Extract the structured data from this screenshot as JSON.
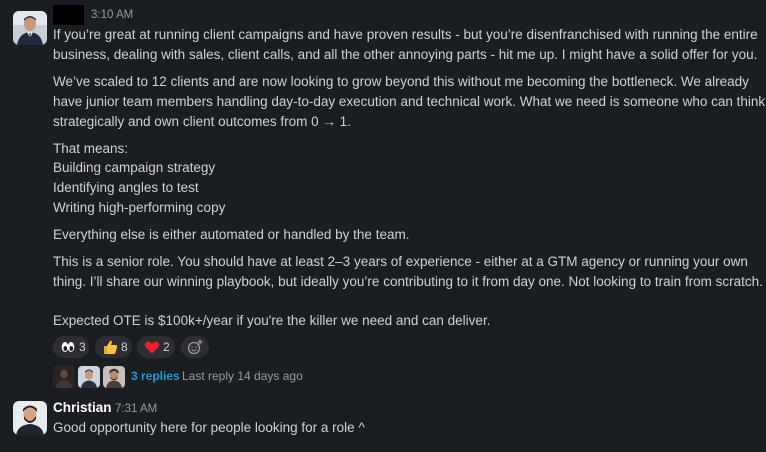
{
  "message1": {
    "time": "3:10 AM",
    "lines": [
      "If you’re great at running client campaigns and have proven results - but you’re disenfranchised with running the entire",
      "business, dealing with sales, client calls, and all the other annoying parts - hit me up. I might have a solid offer for you.",
      "We’ve scaled to 12 clients and are now looking to grow beyond this without me becoming the bottleneck. We already",
      "have junior team members handling day-to-day execution and technical work. What we need is someone who can think",
      "strategically and own client outcomes from 0 → 1.",
      "That means:",
      "Building campaign strategy",
      "Identifying angles to test",
      "Writing high-performing copy",
      "Everything else is either automated or handled by the team.",
      "This is a senior role. You should have at least 2–3 years of experience - either at a GTM agency or running your own",
      "thing. I’ll share our winning playbook, but ideally you’re contributing to it from day one. Not looking to train from scratch.",
      "Expected OTE is $100k+/year if you're the killer we need and can deliver."
    ],
    "reactions": [
      {
        "icon": "eyes-emoji",
        "count": "3"
      },
      {
        "icon": "thumbs-up-emoji",
        "count": "8"
      },
      {
        "icon": "red-heart-emoji",
        "count": "2"
      }
    ],
    "thread": {
      "replies_label": "3 replies",
      "last_reply": "Last reply 14 days ago"
    }
  },
  "message2": {
    "author": "Christian",
    "time": "7:31 AM",
    "text": "Good opportunity here for people looking for a role ^"
  },
  "colors": {
    "background": "#1a1d21",
    "text": "#d1d2d3",
    "muted": "#9a9b9d",
    "link": "#1d9bd1",
    "reaction_bg": "#2c2e33"
  }
}
